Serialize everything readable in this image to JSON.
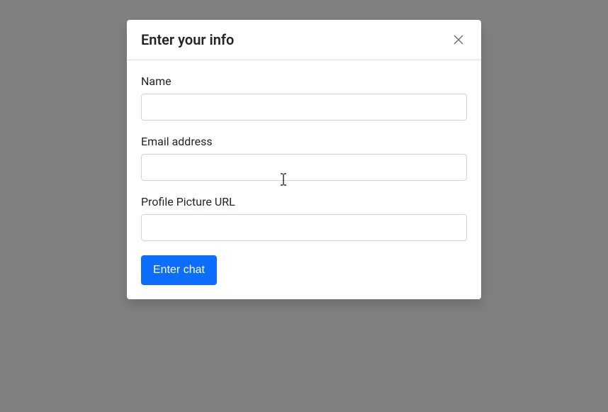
{
  "modal": {
    "title": "Enter your info",
    "fields": {
      "name": {
        "label": "Name",
        "value": ""
      },
      "email": {
        "label": "Email address",
        "value": ""
      },
      "profile_url": {
        "label": "Profile Picture URL",
        "value": ""
      }
    },
    "submit_label": "Enter chat"
  }
}
